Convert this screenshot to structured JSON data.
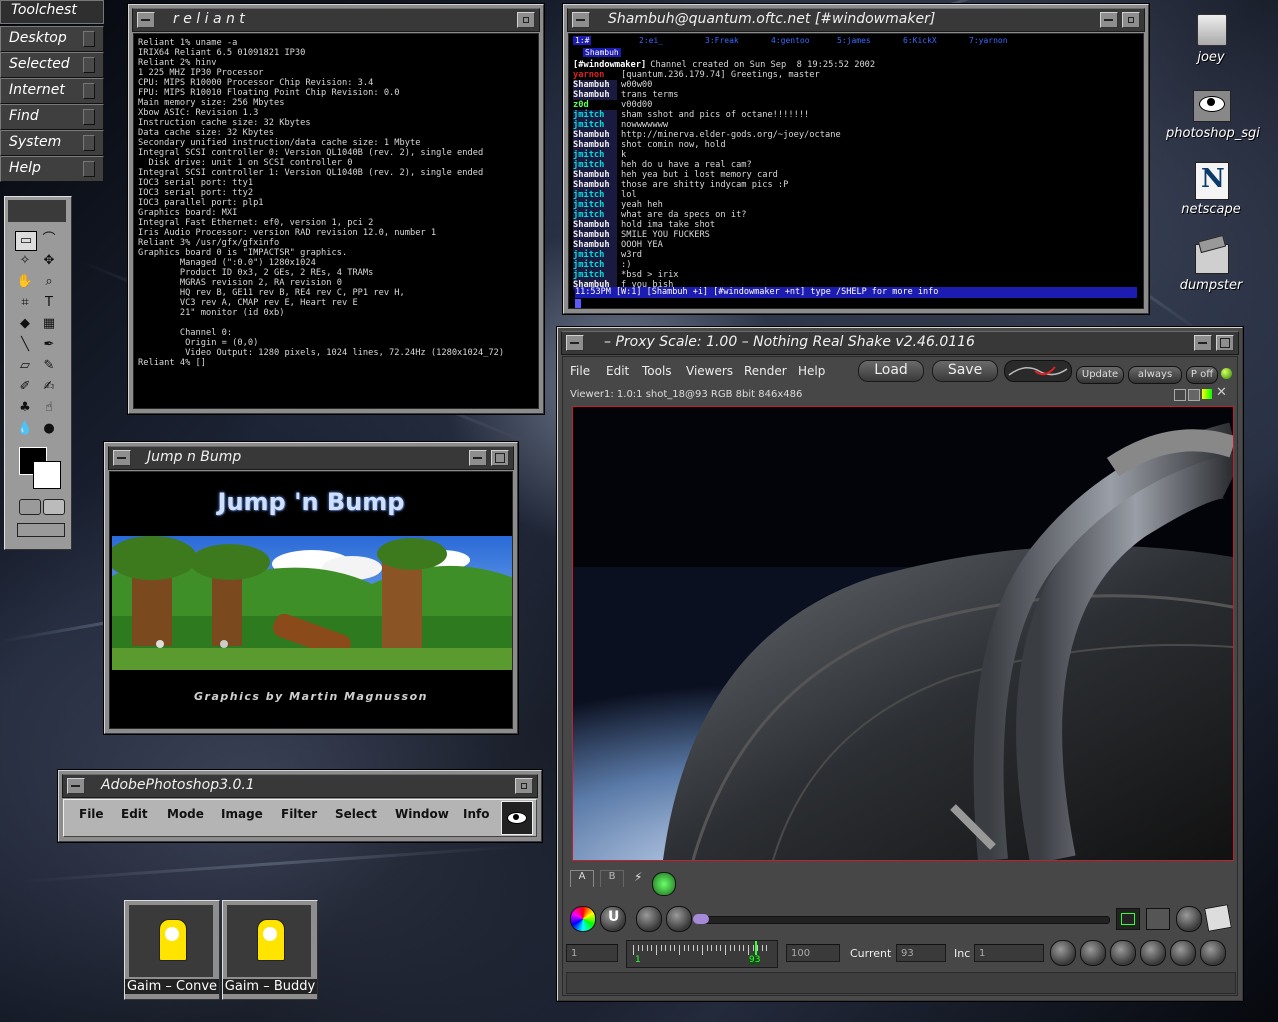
{
  "toolchest": {
    "title": "Toolchest",
    "items": [
      {
        "label": "Desktop"
      },
      {
        "label": "Selected"
      },
      {
        "label": "Internet"
      },
      {
        "label": "Find"
      },
      {
        "label": "System"
      },
      {
        "label": "Help"
      }
    ]
  },
  "terminal": {
    "title": "r e l i a n t",
    "lines": [
      "Reliant 1% uname -a",
      "IRIX64 Reliant 6.5 01091821 IP30",
      "Reliant 2% hinv",
      "1 225 MHZ IP30 Processor",
      "CPU: MIPS R10000 Processor Chip Revision: 3.4",
      "FPU: MIPS R10010 Floating Point Chip Revision: 0.0",
      "Main memory size: 256 Mbytes",
      "Xbow ASIC: Revision 1.3",
      "Instruction cache size: 32 Kbytes",
      "Data cache size: 32 Kbytes",
      "Secondary unified instruction/data cache size: 1 Mbyte",
      "Integral SCSI controller 0: Version QL1040B (rev. 2), single ended",
      "  Disk drive: unit 1 on SCSI controller 0",
      "Integral SCSI controller 1: Version QL1040B (rev. 2), single ended",
      "IOC3 serial port: tty1",
      "IOC3 serial port: tty2",
      "IOC3 parallel port: plp1",
      "Graphics board: MXI",
      "Integral Fast Ethernet: ef0, version 1, pci 2",
      "Iris Audio Processor: version RAD revision 12.0, number 1",
      "Reliant 3% /usr/gfx/gfxinfo",
      "Graphics board 0 is \"IMPACTSR\" graphics.",
      "        Managed (\":0.0\") 1280x1024",
      "        Product ID 0x3, 2 GEs, 2 REs, 4 TRAMs",
      "        MGRAS revision 2, RA revision 0",
      "        HQ rev B, GE11 rev B, RE4 rev C, PP1 rev H,",
      "        VC3 rev A, CMAP rev E, Heart rev E",
      "        21\" monitor (id 0xb)",
      "",
      "        Channel 0:",
      "         Origin = (0,0)",
      "         Video Output: 1280 pixels, 1024 lines, 72.24Hz (1280x1024_72)",
      "Reliant 4% []"
    ]
  },
  "irc": {
    "title": "Shambuh@quantum.oftc.net [#windowmaker]",
    "tabs": [
      "1:#",
      "2:ei_",
      "3:Freak",
      "4:gentoo",
      "5:james",
      "6:KickX",
      "7:yarnon"
    ],
    "tab2": "Shambuh",
    "lines": [
      {
        "nick": "[#windowmaker]",
        "text": "Channel created on Sun Sep  8 19:25:52 2002"
      },
      {
        "nick": "yarnon",
        "text": "[quantum.236.179.74] Greetings, master"
      },
      {
        "nick": "Shambuh",
        "text": "w00w00"
      },
      {
        "nick": "Shambuh",
        "text": "trans terms"
      },
      {
        "nick": "z0d",
        "text": "v00d00"
      },
      {
        "nick": "jmitch",
        "text": "sham sshot and pics of octane!!!!!!!"
      },
      {
        "nick": "jmitch",
        "text": "nowwwwwww"
      },
      {
        "nick": "Shambuh",
        "text": "http://minerva.elder-gods.org/~joey/octane"
      },
      {
        "nick": "Shambuh",
        "text": "shot comin now, hold"
      },
      {
        "nick": "jmitch",
        "text": "k"
      },
      {
        "nick": "jmitch",
        "text": "heh do u have a real cam?"
      },
      {
        "nick": "Shambuh",
        "text": "heh yea but i lost memory card"
      },
      {
        "nick": "Shambuh",
        "text": "those are shitty indycam pics :P"
      },
      {
        "nick": "jmitch",
        "text": "lol"
      },
      {
        "nick": "jmitch",
        "text": "yeah heh"
      },
      {
        "nick": "jmitch",
        "text": "what are da specs on it?"
      },
      {
        "nick": "Shambuh",
        "text": "hold ima take shot"
      },
      {
        "nick": "Shambuh",
        "text": "SMILE YOU FUCKERS"
      },
      {
        "nick": "Shambuh",
        "text": "OOOH YEA"
      },
      {
        "nick": "jmitch",
        "text": "w3rd"
      },
      {
        "nick": "jmitch",
        "text": ":)"
      },
      {
        "nick": "jmitch",
        "text": "*bsd > irix"
      },
      {
        "nick": "Shambuh",
        "text": "f you bish"
      }
    ],
    "status": "11:53PM [W:1] [Shambuh +i] [#windowmaker +nt] type /SHELP for more info"
  },
  "desktop_icons": [
    {
      "label": "joey",
      "icon": "folder-icon"
    },
    {
      "label": "photoshop_sgi",
      "icon": "eye-icon"
    },
    {
      "label": "netscape",
      "icon": "netscape-icon"
    },
    {
      "label": "dumpster",
      "icon": "dumpster-icon"
    }
  ],
  "jumpnbump": {
    "title": "Jump n Bump",
    "game_title": "Jump 'n Bump",
    "credit": "Graphics by Martin Magnusson"
  },
  "photoshop": {
    "title": "AdobePhotoshop3.0.1",
    "menu": [
      "File",
      "Edit",
      "Mode",
      "Image",
      "Filter",
      "Select",
      "Window",
      "Info"
    ]
  },
  "gaim": [
    {
      "label": "Gaim – Conve"
    },
    {
      "label": "Gaim – Buddy"
    }
  ],
  "shake": {
    "title": "– Proxy Scale: 1.00 – Nothing Real Shake v2.46.0116",
    "menu": [
      "File",
      "Edit",
      "Tools",
      "Viewers",
      "Render",
      "Help"
    ],
    "load_label": "Load",
    "save_label": "Save",
    "update_label": "Update",
    "always_label": "always",
    "poff_label": "P off",
    "viewer_label": "Viewer1: 1.0:1 shot_18@93 RGB 8bit 846x486",
    "tab_a": "A",
    "tab_b": "B",
    "start_frame": "1",
    "timeline_start": "1",
    "timeline_marker": "93",
    "end_frame": "100",
    "current_label": "Current",
    "current_value": "93",
    "inc_label": "Inc",
    "inc_value": "1"
  },
  "colors": {
    "irc_bg": "#000000",
    "irc_status": "#1c1cb0",
    "nick_jmitch": "#00e0e0",
    "nick_shambuh": "#f0f0f0",
    "nick_other": "#e02020",
    "viewer_border": "#c02030"
  }
}
